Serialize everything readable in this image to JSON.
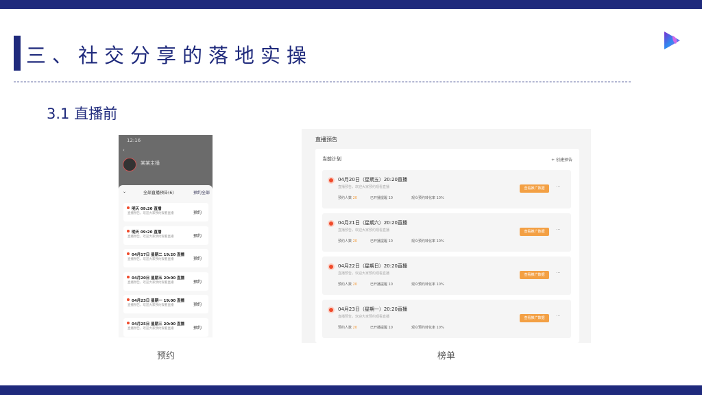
{
  "slide": {
    "title": "三、社交分享的落地实操",
    "subtitle": "3.1 直播前",
    "caption_left": "预约",
    "caption_right": "榜单",
    "accent": "#1f2a7c"
  },
  "phone": {
    "time": "12:16",
    "anchor": "某某主播",
    "sheet_title": "全部直播预告(6)",
    "sheet_action": "预约全部",
    "items": [
      {
        "title": "明天 09:20 直播",
        "desc": "直播预告，欢迎大家预约观看直播",
        "button": "预约"
      },
      {
        "title": "明天 09:20 直播",
        "desc": "直播预告，欢迎大家预约观看直播",
        "button": "预约"
      },
      {
        "title": "04月17日 星期二 19:20 直播",
        "desc": "直播预告，欢迎大家预约观看直播",
        "button": "预约"
      },
      {
        "title": "04月20日 星期五 20:00 直播",
        "desc": "直播预告，欢迎大家预约观看直播",
        "button": "预约"
      },
      {
        "title": "04月23日 星期一 19:00 直播",
        "desc": "直播预告，欢迎大家预约观看直播",
        "button": "预约"
      },
      {
        "title": "04月25日 星期三 20:00 直播",
        "desc": "直播预告，欢迎大家预约观看直播",
        "button": "预约"
      }
    ]
  },
  "panel": {
    "title": "直播预告",
    "section": "当前计划",
    "create": "+ 创建预告",
    "items": [
      {
        "title": "04月20日（星期五）20:20直播",
        "desc": "直播预告，欢迎大家预约观看直播",
        "s1": "预约人数",
        "v1": "20",
        "s2": "已开播提醒",
        "v2": "10",
        "s3": "观众预约转化率",
        "v3": "10%",
        "button": "查看推广数据"
      },
      {
        "title": "04月21日（星期六）20:20直播",
        "desc": "直播预告，欢迎大家预约观看直播",
        "s1": "预约人数",
        "v1": "20",
        "s2": "已开播提醒",
        "v2": "10",
        "s3": "观众预约转化率",
        "v3": "10%",
        "button": "查看推广数据"
      },
      {
        "title": "04月22日（星期日）20:20直播",
        "desc": "直播预告，欢迎大家预约观看直播",
        "s1": "预约人数",
        "v1": "20",
        "s2": "已开播提醒",
        "v2": "10",
        "s3": "观众预约转化率",
        "v3": "10%",
        "button": "查看推广数据"
      },
      {
        "title": "04月23日（星期一）20:20直播",
        "desc": "直播预告，欢迎大家预约观看直播",
        "s1": "预约人数",
        "v1": "20",
        "s2": "已开播提醒",
        "v2": "10",
        "s3": "观众预约转化率",
        "v3": "10%",
        "button": "查看推广数据"
      }
    ]
  }
}
